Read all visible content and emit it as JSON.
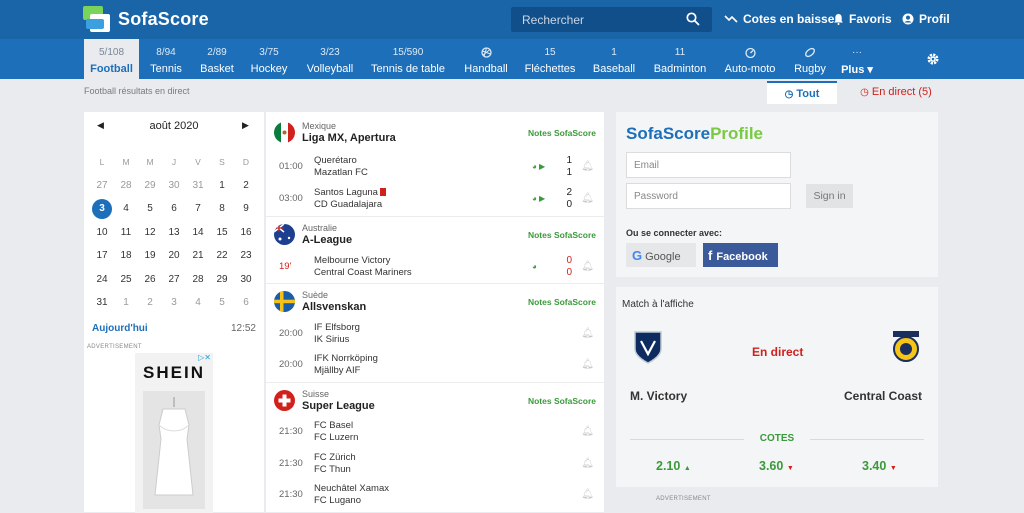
{
  "header": {
    "logo": "SofaScore",
    "search_placeholder": "Rechercher",
    "nav": [
      {
        "label": "Cotes en baisse",
        "icon": "trend-down-icon"
      },
      {
        "label": "Favoris",
        "icon": "bell-icon"
      },
      {
        "label": "Profil",
        "icon": "user-icon"
      }
    ]
  },
  "sports": [
    {
      "count": "5/108",
      "label": "Football",
      "active": true
    },
    {
      "count": "8/94",
      "label": "Tennis"
    },
    {
      "count": "2/89",
      "label": "Basket"
    },
    {
      "count": "3/75",
      "label": "Hockey"
    },
    {
      "count": "3/23",
      "label": "Volleyball"
    },
    {
      "count": "15/590",
      "label": "Tennis de table"
    },
    {
      "count": "",
      "label": "Handball"
    },
    {
      "count": "15",
      "label": "Fléchettes"
    },
    {
      "count": "1",
      "label": "Baseball"
    },
    {
      "count": "11",
      "label": "Badminton"
    },
    {
      "count": "",
      "label": "Auto-moto"
    },
    {
      "count": "",
      "label": "Rugby"
    },
    {
      "count": "···",
      "label": "Plus ▾"
    }
  ],
  "breadcrumb": "Football résultats en direct",
  "tabs": {
    "all": "Tout",
    "live": "En direct (5)"
  },
  "calendar": {
    "month": "août 2020",
    "weekdays": [
      "L",
      "M",
      "M",
      "J",
      "V",
      "S",
      "D"
    ],
    "weeks": [
      [
        "27",
        "28",
        "29",
        "30",
        "31",
        "1",
        "2"
      ],
      [
        "3",
        "4",
        "5",
        "6",
        "7",
        "8",
        "9"
      ],
      [
        "10",
        "11",
        "12",
        "13",
        "14",
        "15",
        "16"
      ],
      [
        "17",
        "18",
        "19",
        "20",
        "21",
        "22",
        "23"
      ],
      [
        "24",
        "25",
        "26",
        "27",
        "28",
        "29",
        "30"
      ],
      [
        "31",
        "1",
        "2",
        "3",
        "4",
        "5",
        "6"
      ]
    ],
    "today_label": "Aujourd'hui",
    "time": "12:52"
  },
  "ads": {
    "label": "ADVERTISEMENT",
    "brand": "SHEIN"
  },
  "leagues": [
    {
      "country": "Mexique",
      "name": "Liga MX, Apertura",
      "notes": "Notes SofaScore",
      "matches": [
        {
          "time": "01:00",
          "home": "Querétaro",
          "away": "Mazatlan FC",
          "sh": "1",
          "sa": "1"
        },
        {
          "time": "03:00",
          "home": "Santos Laguna",
          "away": "CD Guadalajara",
          "sh": "2",
          "sa": "0"
        }
      ]
    },
    {
      "country": "Australie",
      "name": "A-League",
      "notes": "Notes SofaScore",
      "matches": [
        {
          "time": "19'",
          "home": "Melbourne Victory",
          "away": "Central Coast Mariners",
          "sh": "0",
          "sa": "0"
        }
      ]
    },
    {
      "country": "Suède",
      "name": "Allsvenskan",
      "notes": "Notes SofaScore",
      "matches": [
        {
          "time": "20:00",
          "home": "IF Elfsborg",
          "away": "IK Sirius",
          "sh": "",
          "sa": ""
        },
        {
          "time": "20:00",
          "home": "IFK Norrköping",
          "away": "Mjällby AIF",
          "sh": "",
          "sa": ""
        }
      ]
    },
    {
      "country": "Suisse",
      "name": "Super League",
      "notes": "Notes SofaScore",
      "matches": [
        {
          "time": "21:30",
          "home": "FC Basel",
          "away": "FC Luzern",
          "sh": "",
          "sa": ""
        },
        {
          "time": "21:30",
          "home": "FC Zürich",
          "away": "FC Thun",
          "sh": "",
          "sa": ""
        },
        {
          "time": "21:30",
          "home": "Neuchâtel Xamax",
          "away": "FC Lugano",
          "sh": "",
          "sa": ""
        }
      ]
    }
  ],
  "profile": {
    "title_a": "SofaScore",
    "title_b": "Profile",
    "email_placeholder": "Email",
    "password_placeholder": "Password",
    "signin": "Sign in",
    "connect_label": "Ou se connecter avec:",
    "google": "Google",
    "facebook": "Facebook"
  },
  "featured": {
    "label": "Match à l'affiche",
    "status": "En direct",
    "home": "M. Victory",
    "away": "Central Coast",
    "cotes_label": "COTES",
    "odds": [
      "2.10",
      "3.60",
      "3.40"
    ]
  }
}
